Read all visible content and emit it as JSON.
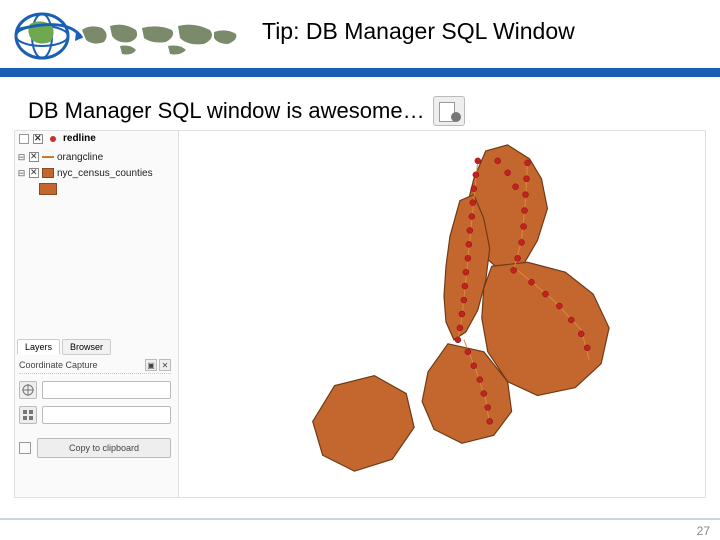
{
  "header": {
    "title": "Tip: DB Manager SQL Window"
  },
  "subtitle": "DB Manager SQL window is awesome…",
  "layers_panel": {
    "top_layer": "redline",
    "items": [
      {
        "label": "orangcline"
      },
      {
        "label": "nyc_census_counties"
      }
    ],
    "tabs": {
      "layers": "Layers",
      "browser": "Browser"
    },
    "coordinate_capture": {
      "title": "Coordinate Capture",
      "copy_button": "Copy to clipboard"
    }
  },
  "footer": {
    "page": "27"
  }
}
